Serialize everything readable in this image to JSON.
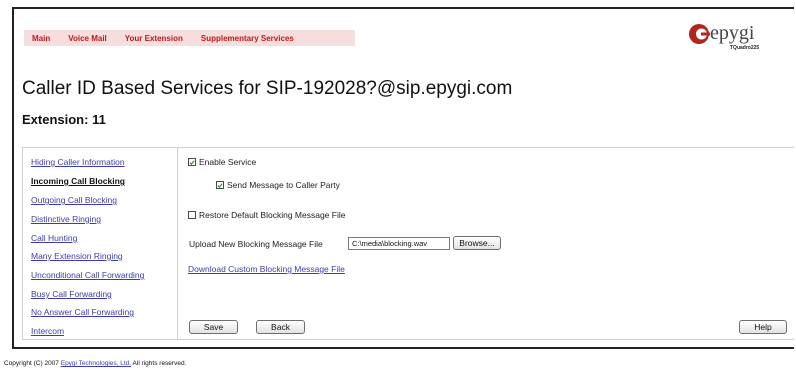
{
  "nav": {
    "items": [
      "Main",
      "Voice Mail",
      "Your Extension",
      "Supplementary Services"
    ]
  },
  "brand": {
    "logo_text": "epygi",
    "model_text": "TQuadro225",
    "icon": "epygi-logo-icon",
    "color": "#b3261e"
  },
  "page": {
    "title": "Caller ID Based Services for SIP-192028?@sip.epygi.com",
    "subtitle": "Extension: 11"
  },
  "sidebar": {
    "items": [
      {
        "label": "Hiding Caller Information",
        "active": false
      },
      {
        "label": "Incoming Call Blocking",
        "active": true
      },
      {
        "label": "Outgoing Call Blocking",
        "active": false
      },
      {
        "label": "Distinctive Ringing",
        "active": false
      },
      {
        "label": "Call Hunting",
        "active": false
      },
      {
        "label": "Many Extension Ringing",
        "active": false
      },
      {
        "label": "Unconditional Call Forwarding",
        "active": false
      },
      {
        "label": "Busy Call Forwarding",
        "active": false
      },
      {
        "label": "No Answer Call Forwarding",
        "active": false
      },
      {
        "label": "Intercom",
        "active": false
      }
    ]
  },
  "form": {
    "enable_service": {
      "label": "Enable Service",
      "checked": true
    },
    "send_message": {
      "label": "Send Message to Caller Party",
      "checked": true
    },
    "restore_default": {
      "label": "Restore Default Blocking Message File",
      "checked": false
    },
    "upload": {
      "label": "Upload New Blocking Message File",
      "value": "C:\\media\\blocking.wav",
      "browse_label": "Browse..."
    },
    "download_link": "Download Custom Blocking Message File"
  },
  "buttons": {
    "save": "Save",
    "back": "Back",
    "help": "Help"
  },
  "footer": {
    "prefix": "Copyright (C) 2007",
    "link": "Epygi Technologies, Ltd.",
    "suffix": "All rights reserved."
  }
}
